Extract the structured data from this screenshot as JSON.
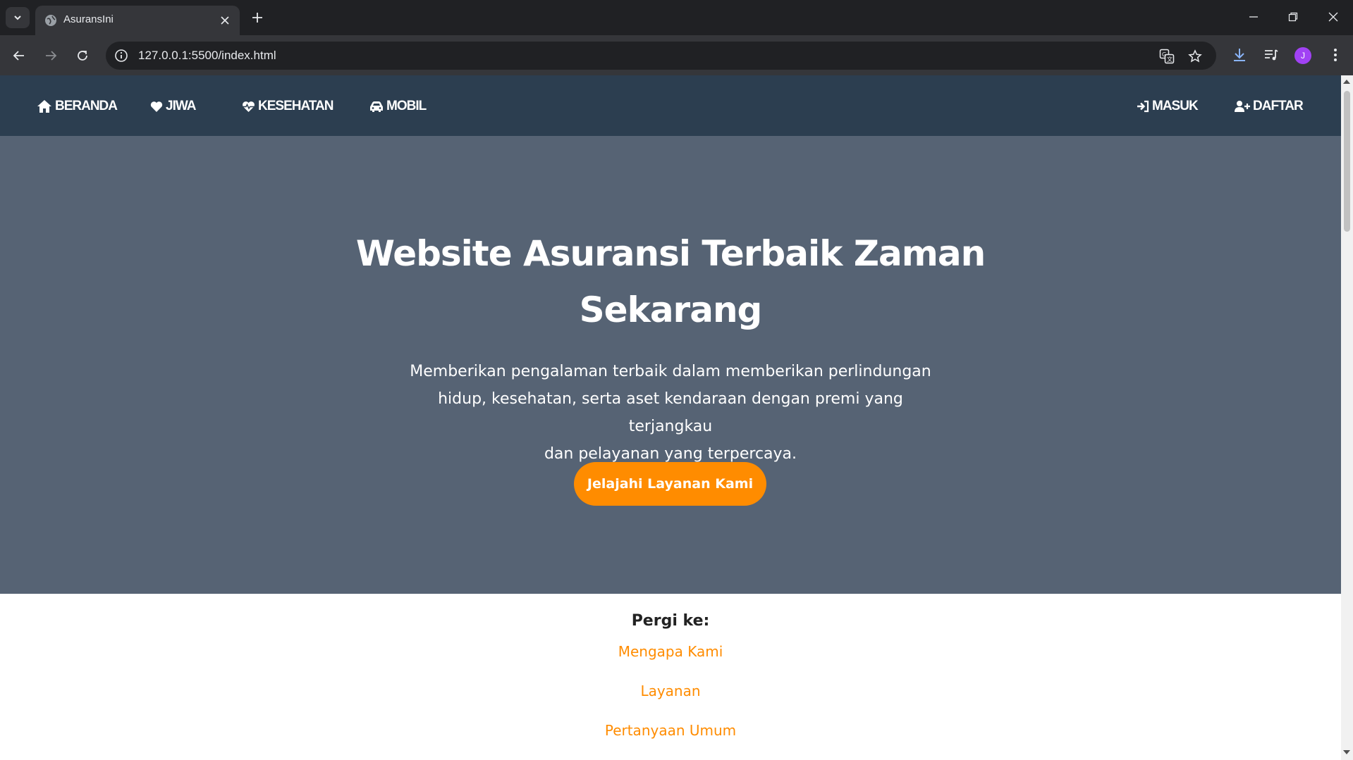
{
  "browser": {
    "tab": {
      "title": "AsuransIni"
    },
    "omnibox": {
      "url": "127.0.0.1:5500/index.html"
    },
    "avatar": {
      "initial": "J",
      "color": "#a142f4"
    }
  },
  "site_nav": {
    "left_items": [
      {
        "label": "BERANDA",
        "icon": "home-icon"
      },
      {
        "label": "JIWA",
        "icon": "heart-icon"
      },
      {
        "label": "KESEHATAN",
        "icon": "heart-pulse-icon"
      },
      {
        "label": "MOBIL",
        "icon": "car-icon"
      }
    ],
    "right_items": [
      {
        "label": "MASUK",
        "icon": "sign-in-icon"
      },
      {
        "label": "DAFTAR",
        "icon": "user-plus-icon"
      }
    ]
  },
  "hero": {
    "title_line1": "Website Asuransi Terbaik Zaman",
    "title_line2": "Sekarang",
    "subtitle_line1": "Memberikan pengalaman terbaik dalam memberikan perlindungan",
    "subtitle_line2": "hidup, kesehatan, serta aset kendaraan dengan premi yang terjangkau",
    "subtitle_line3": "dan pelayanan yang terpercaya.",
    "cta_label": "Jelajahi Layanan Kami"
  },
  "goto": {
    "heading": "Pergi ke:",
    "links": [
      "Mengapa Kami",
      "Layanan",
      "Pertanyaan Umum"
    ]
  },
  "colors": {
    "nav_bg": "#2c3e50",
    "hero_bg": "#566374",
    "accent": "#ff8c00"
  }
}
